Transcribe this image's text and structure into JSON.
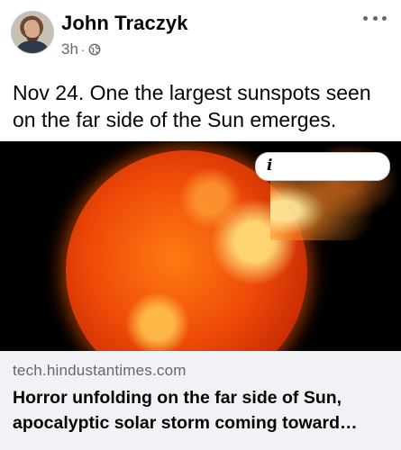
{
  "post": {
    "author": "John Traczyk",
    "time": "3h",
    "separator": "·",
    "text": "Nov 24. One the largest sunspots seen on the far side of the Sun emerges."
  },
  "image": {
    "info_icon_glyph": "i"
  },
  "link": {
    "domain": "tech.hindustantimes.com",
    "headline_line1": "Horror unfolding on the far side of Sun,",
    "headline_line2": "apocalyptic solar storm coming toward…"
  },
  "icons": {
    "audience": "globe-icon",
    "more": "more-horizontal-icon",
    "info": "info-icon"
  },
  "colors": {
    "text_primary": "#050505",
    "text_secondary": "#65676b",
    "link_card_bg": "#f0f2f5"
  }
}
